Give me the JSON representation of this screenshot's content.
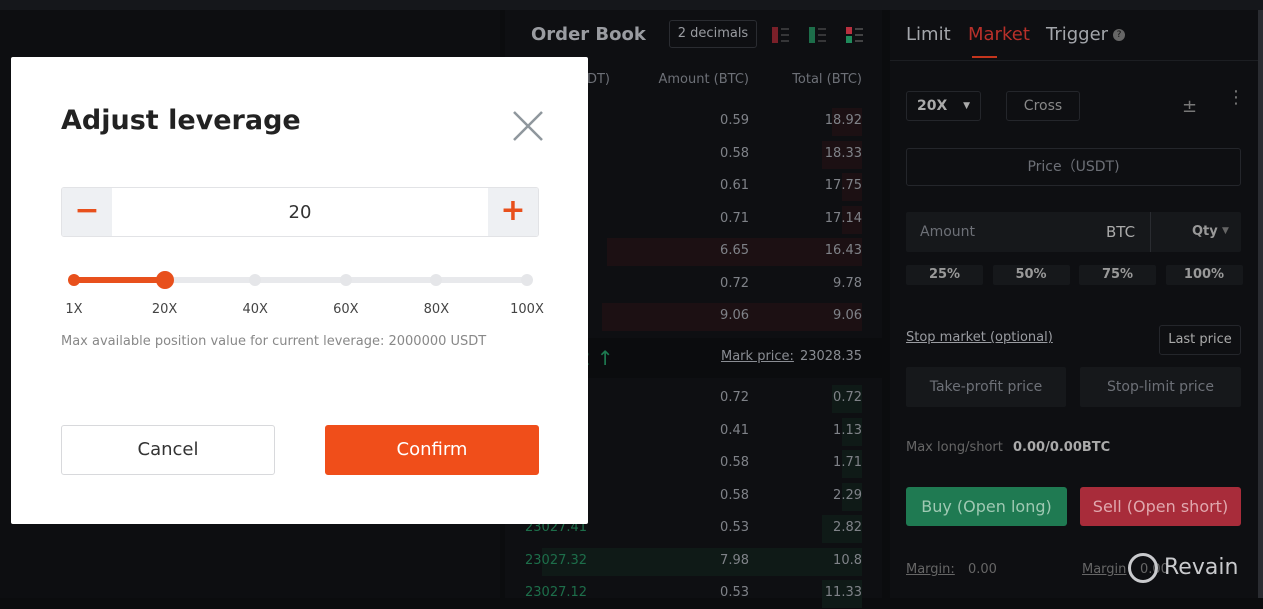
{
  "order_book": {
    "title": "Order Book",
    "decimals": "2 decimals",
    "columns": [
      "Price (USDT)",
      "Amount (BTC)",
      "Total (BTC)"
    ],
    "asks": [
      {
        "amount": "0.59",
        "total": "18.92"
      },
      {
        "amount": "0.58",
        "total": "18.33"
      },
      {
        "amount": "0.61",
        "total": "17.75"
      },
      {
        "amount": "0.71",
        "total": "17.14"
      },
      {
        "amount": "6.65",
        "total": "16.43"
      },
      {
        "amount": "0.72",
        "total": "9.78"
      },
      {
        "amount": "9.06",
        "total": "9.06"
      }
    ],
    "last_price_fragment": "12 ↑",
    "mark_price_label": "Mark price:",
    "mark_price": "23028.35",
    "bids": [
      {
        "price": "",
        "amount": "0.72",
        "total": "0.72"
      },
      {
        "price": "",
        "amount": "0.41",
        "total": "1.13"
      },
      {
        "price": "",
        "amount": "0.58",
        "total": "1.71"
      },
      {
        "price": "",
        "amount": "0.58",
        "total": "2.29"
      },
      {
        "price": "23027.41",
        "amount": "0.53",
        "total": "2.82"
      },
      {
        "price": "23027.32",
        "amount": "7.98",
        "total": "10.8"
      },
      {
        "price": "23027.12",
        "amount": "0.53",
        "total": "11.33"
      }
    ]
  },
  "trade": {
    "tabs": [
      "Limit",
      "Market",
      "Trigger"
    ],
    "active_tab": "Market",
    "leverage": "20X",
    "margin_mode": "Cross",
    "price_placeholder": "Price（USDT)",
    "amount_placeholder": "Amount",
    "amount_unit": "BTC",
    "qty": "Qty",
    "percents": [
      "25%",
      "50%",
      "75%",
      "100%"
    ],
    "stop_market": "Stop market (optional)",
    "last_price": "Last price",
    "take_profit": "Take-profit price",
    "stop_limit": "Stop-limit price",
    "max_label": "Max long/short",
    "max_value": "0.00/0.00BTC",
    "buy": "Buy (Open long)",
    "sell": "Sell (Open short)",
    "margin_label": "Margin:",
    "margin_value": "0.00",
    "margin_label2": "Margin",
    "margin_value2": "0.00"
  },
  "modal": {
    "title": "Adjust leverage",
    "value": "20",
    "slider_value": 20,
    "slider_max": 100,
    "ticks": [
      "1X",
      "20X",
      "40X",
      "60X",
      "80X",
      "100X"
    ],
    "info": "Max available position value for current leverage: 2000000 USDT",
    "cancel": "Cancel",
    "confirm": "Confirm"
  },
  "colors": {
    "accent": "#f04e1a",
    "buy": "#1f8a5b",
    "sell": "#b8303f"
  },
  "watermark": "Revain"
}
